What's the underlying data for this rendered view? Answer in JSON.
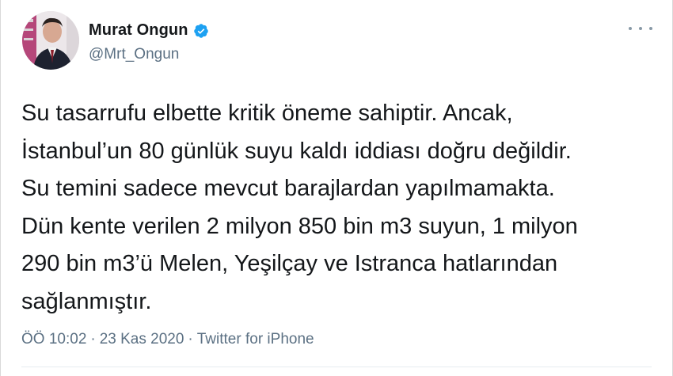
{
  "user": {
    "name": "Murat Ongun",
    "handle": "@Mrt_Ongun",
    "verified": true,
    "accent_color": "#1da1f2"
  },
  "tweet": {
    "lines": [
      "Su tasarrufu elbette kritik öneme sahiptir. Ancak,",
      "İstanbul’un 80 günlük suyu kaldı iddiası doğru değildir.",
      "Su temini sadece mevcut barajlardan yapılmamakta.",
      "Dün kente verilen 2 milyon 850 bin m3 suyun, 1 milyon",
      "290 bin m3’ü Melen, Yeşilçay ve Istranca hatlarından",
      "sağlanmıştır."
    ]
  },
  "meta": {
    "time": "ÖÖ 10:02",
    "separator": "·",
    "date": "23 Kas 2020",
    "source": "Twitter for iPhone"
  },
  "icons": {
    "verified": "verified-badge-icon",
    "more": "more-options-icon"
  }
}
